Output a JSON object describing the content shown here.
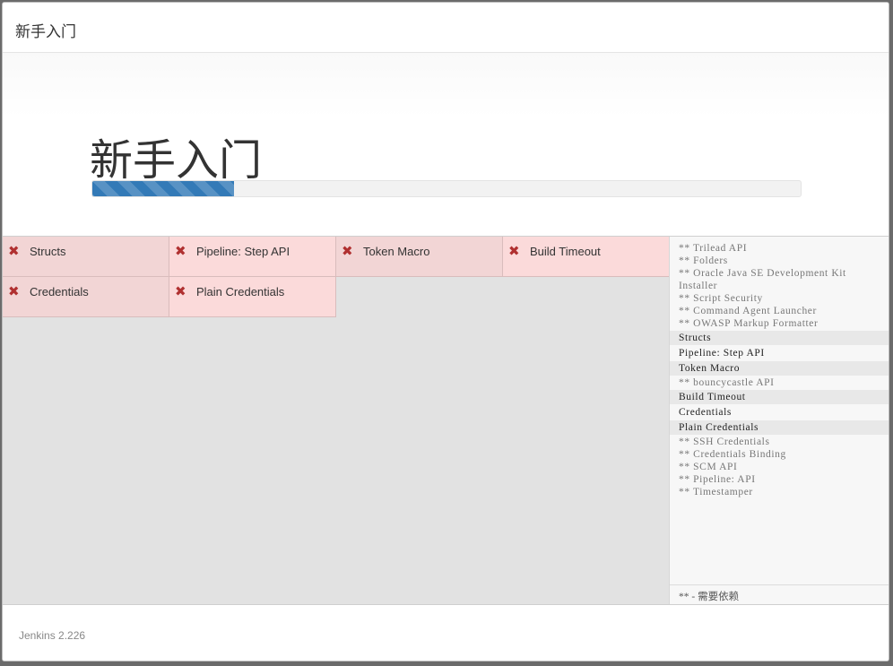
{
  "dialog": {
    "title": "新手入门",
    "heading": "新手入门",
    "progress": 0.2
  },
  "plugins": [
    {
      "name": "Structs",
      "status": "failed"
    },
    {
      "name": "Pipeline: Step API",
      "status": "failed"
    },
    {
      "name": "Token Macro",
      "status": "failed"
    },
    {
      "name": "Build Timeout",
      "status": "failed"
    },
    {
      "name": "Credentials",
      "status": "failed"
    },
    {
      "name": "Plain Credentials",
      "status": "failed"
    }
  ],
  "log": {
    "lines": [
      {
        "text": "** Trilead API",
        "type": "dep"
      },
      {
        "text": "** Folders",
        "type": "dep"
      },
      {
        "text": "** Oracle Java SE Development Kit",
        "type": "dep"
      },
      {
        "text": "Installer",
        "type": "dep"
      },
      {
        "text": "** Script Security",
        "type": "dep"
      },
      {
        "text": "** Command Agent Launcher",
        "type": "dep"
      },
      {
        "text": "** OWASP Markup Formatter",
        "type": "dep"
      },
      {
        "text": "Structs",
        "type": "main"
      },
      {
        "text": "Pipeline: Step API",
        "type": "main-light"
      },
      {
        "text": "Token Macro",
        "type": "main"
      },
      {
        "text": "** bouncycastle API",
        "type": "dep"
      },
      {
        "text": "Build Timeout",
        "type": "main"
      },
      {
        "text": "Credentials",
        "type": "main-light"
      },
      {
        "text": "Plain Credentials",
        "type": "main"
      },
      {
        "text": "** SSH Credentials",
        "type": "dep"
      },
      {
        "text": "** Credentials Binding",
        "type": "dep"
      },
      {
        "text": "** SCM API",
        "type": "dep"
      },
      {
        "text": "** Pipeline: API",
        "type": "dep"
      },
      {
        "text": "** Timestamper",
        "type": "dep"
      }
    ],
    "footer": "** - 需要依赖"
  },
  "footer": {
    "version": "Jenkins 2.226"
  },
  "icons": {
    "failed": "✖"
  }
}
